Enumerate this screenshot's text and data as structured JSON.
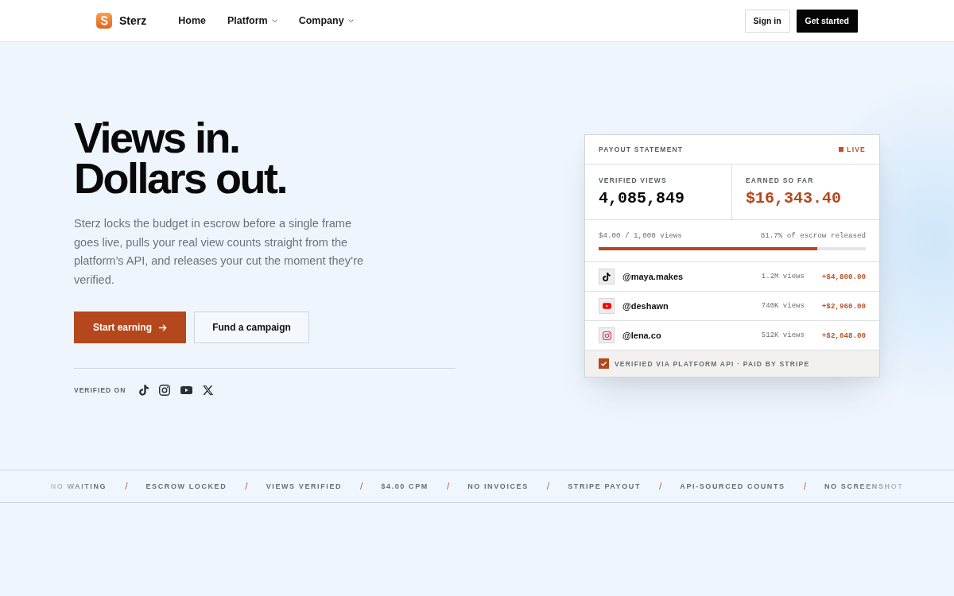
{
  "header": {
    "brand": "Sterz",
    "nav": [
      {
        "label": "Home",
        "kind": "link"
      },
      {
        "label": "Platform",
        "kind": "menu"
      },
      {
        "label": "Company",
        "kind": "menu"
      }
    ],
    "actions": [
      {
        "label": "Sign in",
        "kind": "secondary"
      },
      {
        "label": "Get started",
        "kind": "primary"
      }
    ]
  },
  "hero": {
    "headline": "Views in. Dollars out.",
    "body": "Sterz locks the budget in escrow before a single frame goes live, pulls your real view counts straight from the platform’s API, and releases your cut the moment they’re verified.",
    "buttons": [
      {
        "label": "Start earning",
        "kind": "primary"
      },
      {
        "label": "Fund a campaign",
        "kind": "secondary"
      }
    ],
    "verified_on": {
      "label": "VERIFIED ON",
      "platforms": [
        {
          "kind": "tiktok"
        },
        {
          "kind": "instagram"
        },
        {
          "kind": "youtube"
        },
        {
          "kind": "x"
        }
      ]
    }
  },
  "payout_card": {
    "title": "PAYOUT STATEMENT",
    "status": "LIVE",
    "stats": [
      {
        "label": "VERIFIED VIEWS",
        "value": "4,085,849",
        "kind": "count"
      },
      {
        "label": "EARNED SO FAR",
        "value": "$16,343.40",
        "kind": "money"
      }
    ],
    "rate": "$4.00 / 1,000 views",
    "released": "81.7% of escrow released",
    "progress": {
      "level": 0.817
    },
    "creators": [
      {
        "kind": "tiktok",
        "handle": "@maya.makes",
        "views": "1.2M views",
        "amount": "+$4,800.00"
      },
      {
        "kind": "youtube",
        "handle": "@deshawn",
        "views": "740K views",
        "amount": "+$2,960.00"
      },
      {
        "kind": "instagram",
        "handle": "@lena.co",
        "views": "512K views",
        "amount": "+$2,048.00"
      }
    ],
    "footer": "VERIFIED VIA PLATFORM API · PAID BY STRIPE"
  },
  "ticker": [
    {
      "label": "NO WAITING",
      "separator": "/"
    },
    {
      "label": "ESCROW LOCKED",
      "separator": "/"
    },
    {
      "label": "VIEWS VERIFIED",
      "separator": "/"
    },
    {
      "label": "$4.00 CPM",
      "separator": "/"
    },
    {
      "label": "NO INVOICES",
      "separator": "/"
    },
    {
      "label": "STRIPE PAYOUT",
      "separator": "/"
    },
    {
      "label": "API-SOURCED COUNTS",
      "separator": "/"
    },
    {
      "label": "NO SCREENSHOT"
    }
  ]
}
